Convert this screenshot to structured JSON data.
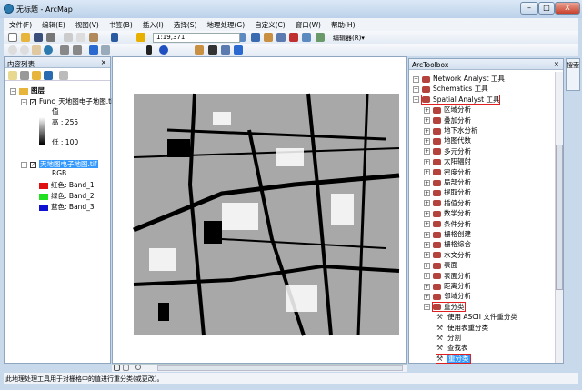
{
  "window": {
    "title": "无标题 - ArcMap",
    "minimize": "–",
    "maximize": "□",
    "close": "X"
  },
  "menu": [
    "文件(F)",
    "编辑(E)",
    "视图(V)",
    "书签(B)",
    "插入(I)",
    "选择(S)",
    "地理处理(G)",
    "自定义(C)",
    "窗口(W)",
    "帮助(H)"
  ],
  "toolbar": {
    "scale": "1:19,371",
    "editor": "编辑器(R)▾"
  },
  "toc": {
    "title": "内容列表",
    "pin": "ᅲ",
    "close": "×",
    "group": "图层",
    "layer1": {
      "name": "Func_天地图电子地图.tif",
      "value_label": "值",
      "high": "高 : 255",
      "low": "低 : 100"
    },
    "layer2": {
      "name": "天地图电子地图.tif",
      "rgb": "RGB",
      "bands": [
        {
          "label": "红色:",
          "band": "Band_1",
          "color": "#e01010"
        },
        {
          "label": "绿色:",
          "band": "Band_2",
          "color": "#20e020"
        },
        {
          "label": "蓝色:",
          "band": "Band_3",
          "color": "#1010d0"
        }
      ]
    }
  },
  "toolbox": {
    "title": "ArcToolbox",
    "float": "□",
    "close": "×",
    "top": [
      "Network Analyst 工具",
      "Schematics 工具",
      "Spatial Analyst 工具"
    ],
    "spatial": [
      "区域分析",
      "叠加分析",
      "地下水分析",
      "地图代数",
      "多元分析",
      "太阳辐射",
      "密度分析",
      "局部分析",
      "提取分析",
      "插值分析",
      "数学分析",
      "条件分析",
      "栅格创建",
      "栅格综合",
      "水文分析",
      "表面",
      "表面分析",
      "距离分析",
      "邻域分析"
    ],
    "reclass": "重分类",
    "reclass_tools": [
      "使用 ASCII 文件重分类",
      "使用表重分类",
      "分割",
      "查找表",
      "重分类"
    ]
  },
  "side_tab": "搜索",
  "status": "此地理处理工具用于对栅格中的值进行重分类(或更改)。"
}
